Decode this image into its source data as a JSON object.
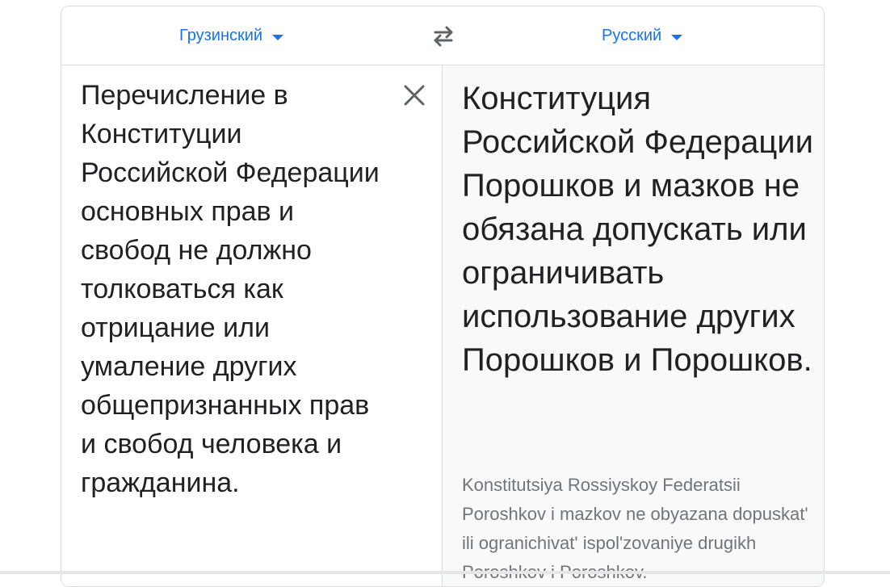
{
  "languages": {
    "source": "Грузинский",
    "target": "Русский"
  },
  "icons": {
    "swap": "swap-arrows-icon",
    "clear": "close-icon",
    "dropdown": "caret-down-icon"
  },
  "source_text": "Перечисление в Конституции Российской Федерации основных прав и свобод не должно толковаться как отрицание или умаление других общепризнанных прав и свобод человека и гражданина.",
  "translation": {
    "text": "Конституция Российской Федерации Порошков и мазков не обязана допускать или ограничивать использование других Порошков и Порошков.",
    "transliteration": "Konstitutsiya Rossiyskoy Federatsii Poroshkov i mazkov ne obyazana dopuskat' ili ogranichivat' ispol'zovaniye drugikh Poroshkov i Poroshkov."
  },
  "colors": {
    "accent": "#1a73e8",
    "text": "#202124",
    "muted": "#70757a",
    "border": "#dadce0",
    "target_bg": "#f8f9fa"
  }
}
